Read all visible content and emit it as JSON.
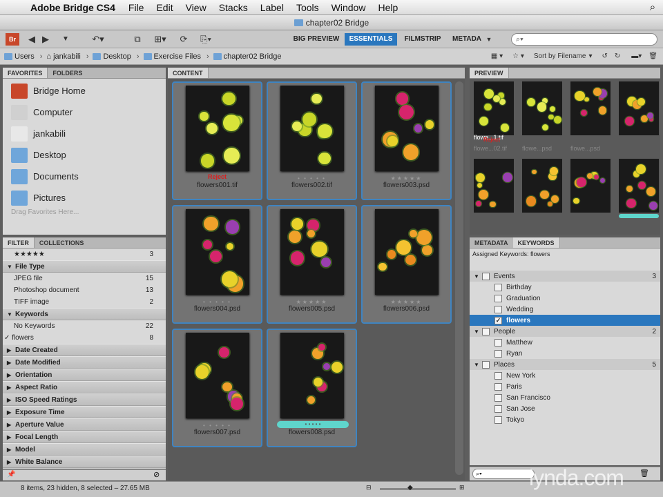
{
  "menubar": {
    "app": "Adobe Bridge CS4",
    "items": [
      "File",
      "Edit",
      "View",
      "Stacks",
      "Label",
      "Tools",
      "Window",
      "Help"
    ]
  },
  "window": {
    "title": "chapter02 Bridge"
  },
  "toolbar": {
    "workspaces": [
      "BIG PREVIEW",
      "ESSENTIALS",
      "FILMSTRIP",
      "METADA"
    ]
  },
  "path": [
    "Users",
    "jankabili",
    "Desktop",
    "Exercise Files",
    "chapter02 Bridge"
  ],
  "content_toolbar": {
    "sort": "Sort by Filename"
  },
  "left_tabs": {
    "favorites": "FAVORITES",
    "folders": "FOLDERS"
  },
  "favorites": [
    {
      "label": "Bridge Home",
      "icon": "bridge-home-icon",
      "color": "#c8472a"
    },
    {
      "label": "Computer",
      "icon": "computer-icon",
      "color": "#d0d0d0"
    },
    {
      "label": "jankabili",
      "icon": "home-icon",
      "color": "#e8e8e8"
    },
    {
      "label": "Desktop",
      "icon": "folder-icon",
      "color": "#6fa6da"
    },
    {
      "label": "Documents",
      "icon": "folder-icon",
      "color": "#6fa6da"
    },
    {
      "label": "Pictures",
      "icon": "folder-icon",
      "color": "#6fa6da"
    }
  ],
  "favorites_hint": "Drag Favorites Here...",
  "filter_tabs": {
    "filter": "FILTER",
    "collections": "COLLECTIONS"
  },
  "filter": {
    "rating": {
      "label": "★★★★★",
      "count": "3"
    },
    "file_type": {
      "label": "File Type",
      "items": [
        {
          "label": "JPEG file",
          "count": "15"
        },
        {
          "label": "Photoshop document",
          "count": "13"
        },
        {
          "label": "TIFF image",
          "count": "2"
        }
      ]
    },
    "keywords": {
      "label": "Keywords",
      "items": [
        {
          "label": "No Keywords",
          "count": "22"
        },
        {
          "label": "flowers",
          "count": "8",
          "checked": "✓"
        }
      ]
    },
    "collapsed": [
      "Date Created",
      "Date Modified",
      "Orientation",
      "Aspect Ratio",
      "ISO Speed Ratings",
      "Exposure Time",
      "Aperture Value",
      "Focal Length",
      "Model",
      "White Balance"
    ]
  },
  "content_tab": "CONTENT",
  "thumbnails": [
    {
      "name": "flowers001.tif",
      "stars": "",
      "reject": "Reject",
      "palette": "yellow"
    },
    {
      "name": "flowers002.tif",
      "stars": "• • • • •",
      "reject": "",
      "palette": "yellow"
    },
    {
      "name": "flowers003.psd",
      "stars": "★★★★★",
      "reject": "",
      "palette": "mix"
    },
    {
      "name": "flowers004.psd",
      "stars": "• • • • •",
      "reject": "",
      "palette": "mix"
    },
    {
      "name": "flowers005.psd",
      "stars": "★★★★★",
      "reject": "",
      "palette": "mix"
    },
    {
      "name": "flowers006.psd",
      "stars": "★★★★★",
      "reject": "",
      "palette": "orange"
    },
    {
      "name": "flowers007.psd",
      "stars": "• • • • •",
      "reject": "",
      "palette": "mix"
    },
    {
      "name": "flowers008.psd",
      "stars": "• • • • •",
      "reject": "",
      "palette": "mix",
      "label_color": "#5fd5cc"
    }
  ],
  "preview_tab": "PREVIEW",
  "preview_labels": [
    "Reject",
    "flowe...1.tif",
    "flowe...02.tif",
    "flowe...psd",
    "flowe...psd"
  ],
  "right_tabs": {
    "metadata": "METADATA",
    "keywords": "KEYWORDS"
  },
  "assigned_keywords": "Assigned Keywords: flowers",
  "keywords": [
    {
      "label": "Events",
      "count": "3",
      "level": 0,
      "items": [
        "Birthday",
        "Graduation",
        "Wedding",
        "flowers"
      ]
    },
    {
      "label": "People",
      "count": "2",
      "level": 0,
      "items": [
        "Matthew",
        "Ryan"
      ]
    },
    {
      "label": "Places",
      "count": "5",
      "level": 0,
      "items": [
        "New York",
        "Paris",
        "San Francisco",
        "San Jose",
        "Tokyo"
      ]
    }
  ],
  "status": "8 items, 23 hidden, 8 selected – 27.65 MB",
  "watermark": "lynda.com"
}
